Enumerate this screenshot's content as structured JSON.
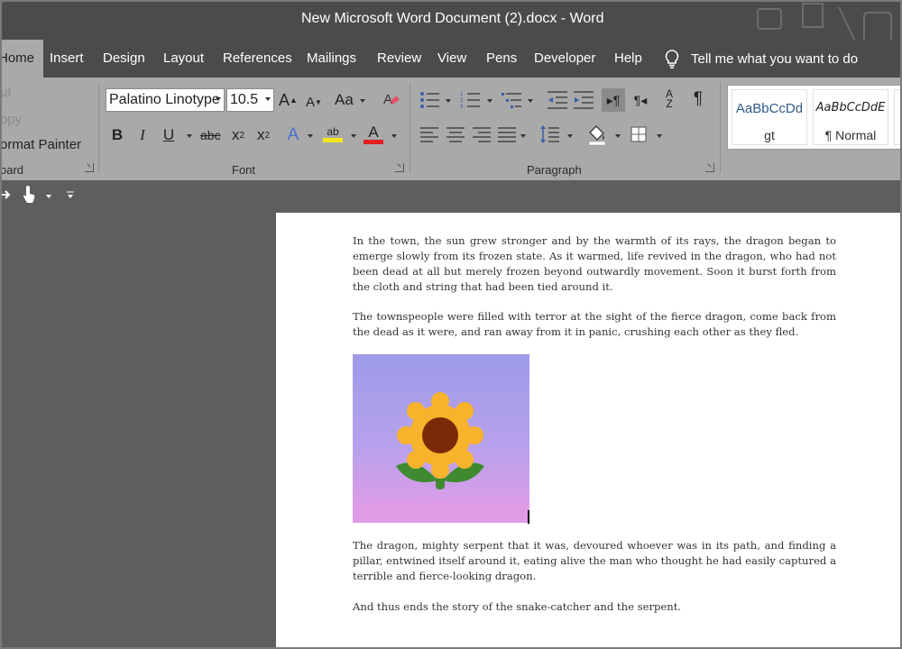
{
  "window": {
    "title": "New Microsoft Word Document (2).docx  -  Word"
  },
  "tabs": [
    {
      "label": "Home",
      "active": true
    },
    {
      "label": "Insert"
    },
    {
      "label": "Design"
    },
    {
      "label": "Layout"
    },
    {
      "label": "References"
    },
    {
      "label": "Mailings"
    },
    {
      "label": "Review"
    },
    {
      "label": "View"
    },
    {
      "label": "Pens"
    },
    {
      "label": "Developer"
    },
    {
      "label": "Help"
    }
  ],
  "tell_me": {
    "label": "Tell me what you want to do",
    "icon": "lightbulb-icon"
  },
  "ribbon": {
    "clipboard": {
      "cut": "ut",
      "copy": "opy",
      "format_painter": "ormat Painter",
      "group_label": "oard"
    },
    "font": {
      "font_name": "Palatino Linotype",
      "font_size": "10.5",
      "group_label": "Font",
      "grow": "A",
      "shrink": "A",
      "change_case": "Aa",
      "bold": "B",
      "italic": "I",
      "underline": "U",
      "strike": "abc",
      "subscript": "x",
      "subscript_num": "2",
      "superscript": "x",
      "superscript_num": "2",
      "text_effects": "A",
      "highlight_text": "ab",
      "font_color": "A",
      "highlight_color": "#f5e61b",
      "font_color_value": "#e02020"
    },
    "paragraph": {
      "group_label": "Paragraph",
      "sort": "A",
      "sort_sub": "Z",
      "pilcrow": "¶"
    },
    "styles": [
      {
        "sample": "AaBbCcDd",
        "name": "gt",
        "color": "#2e5a8a"
      },
      {
        "sample": "AaBbCcDdE",
        "name": "¶ Normal",
        "color": "#222222"
      }
    ]
  },
  "document": {
    "paragraphs": [
      "In the town, the sun grew stronger and by the warmth of its rays, the dragon began to emerge slowly from its frozen state. As it warmed, life revived in the dragon, who had not been dead at all but merely frozen beyond outwardly movement. Soon it burst forth from the cloth and string that had been tied around it.",
      "The townspeople were filled with terror at the sight of the fierce dragon, come back from the dead as it were, and ran away from it in panic, crushing each other as they fled.",
      "The dragon, mighty serpent that it was, devoured whoever was in its path, and finding a pillar, entwined itself around it, eating alive the man who thought he had easily captured a terrible and fierce-looking dragon.",
      "And thus ends the story of the snake-catcher and the serpent."
    ],
    "image": {
      "icon": "sunflower-icon",
      "gradient_top": "#9e9be8",
      "gradient_bottom": "#e79be6",
      "petal_color": "#f6b32b",
      "center_color": "#7a2a07",
      "leaf_color": "#3f8a2e"
    }
  }
}
